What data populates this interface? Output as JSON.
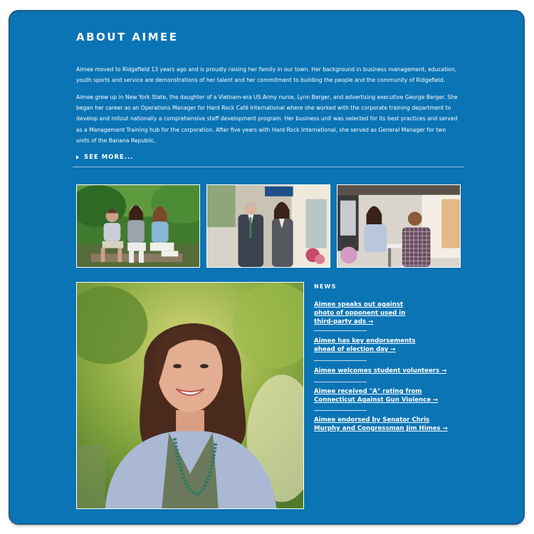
{
  "about": {
    "heading": "ABOUT AIMEE",
    "paragraph_1": "Aimee moved to Ridgefield 13 years ago and is proudly raising her family in our town. Her background in business management, education, youth sports and service are demonstrations of her talent and her commitment to building the people and the community of Ridgefield.",
    "paragraph_2": "Aimee grew up in New York State, the daughter of a Vietnam-era US Army nurse, Lynn Berger, and advertising executive George Berger. She began her career as an Operations Manager for Hard Rock Café International where she worked with the corporate training department to develop and rollout nationally a comprehensive staff development program. Her business unit was selected for its best practices and served as a Management Training hub for the corporation. After five years with Hard Rock International, she served as General Manager for two units of the Banana Republic.",
    "see_more": "SEE MORE..."
  },
  "news": {
    "heading": "NEWS",
    "items": [
      {
        "label": "Aimee speaks out against photo of opponent used in third-party ads →"
      },
      {
        "label": "Aimee has key endorsements ahead of election day →"
      },
      {
        "label": "Aimee welcomes student volunteers →"
      },
      {
        "label": "Aimee received \"A\" rating from Connecticut Against Gun Violence →"
      },
      {
        "label": "Aimee endorsed by Senator Chris Murphy and Congressman Jim Himes →"
      }
    ]
  },
  "colors": {
    "background": "#0b74b5",
    "text": "#ffffff"
  }
}
